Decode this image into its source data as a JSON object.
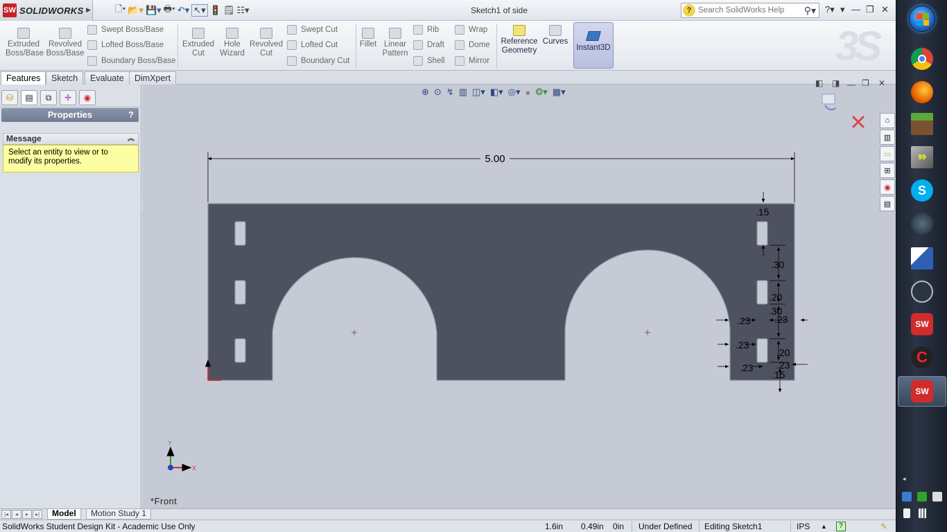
{
  "app": {
    "name": "SOLIDWORKS",
    "logo_text": "SW",
    "doc_title": "Sketch1 of side"
  },
  "search": {
    "placeholder": "Search SolidWorks Help"
  },
  "commands": {
    "extruded_boss": "Extruded Boss/Base",
    "revolved_boss": "Revolved Boss/Base",
    "swept_boss": "Swept Boss/Base",
    "lofted_boss": "Lofted Boss/Base",
    "boundary_boss": "Boundary Boss/Base",
    "extruded_cut": "Extruded Cut",
    "hole_wizard": "Hole Wizard",
    "revolved_cut": "Revolved Cut",
    "swept_cut": "Swept Cut",
    "lofted_cut": "Lofted Cut",
    "boundary_cut": "Boundary Cut",
    "fillet": "Fillet",
    "linear_pattern": "Linear Pattern",
    "rib": "Rib",
    "draft": "Draft",
    "shell": "Shell",
    "wrap": "Wrap",
    "dome": "Dome",
    "mirror": "Mirror",
    "reference_geometry": "Reference Geometry",
    "curves": "Curves",
    "instant3d": "Instant3D"
  },
  "tabs": [
    "Features",
    "Sketch",
    "Evaluate",
    "DimXpert"
  ],
  "panel": {
    "title": "Properties",
    "help": "?",
    "message_header": "Message",
    "message_text": "Select an entity to view or to modify its properties."
  },
  "sketch": {
    "overall_width": "5.00",
    "dims": {
      "top_margin": ".15",
      "slot_spacing": ".30",
      "slot_height": ".20",
      "slot_spacing_2": ".30",
      "left_offset": ".23",
      "right_offset": ".23",
      "mid_offset": ".23",
      "slot_height_2": ".20",
      "bottom_offset": ".23",
      "lower_offset": ".23",
      "bottom_margin": ".15"
    },
    "colors": {
      "body": "#4e5260",
      "background": "#c6cad4",
      "dimension": "#000000"
    }
  },
  "triad": {
    "x_label": "X",
    "y_label": "Y"
  },
  "view_label": "*Front",
  "bottom_tabs": [
    "Model",
    "Motion Study 1"
  ],
  "status": {
    "kit": "SolidWorks Student Design Kit - Academic Use Only",
    "x": "1.6in",
    "y": "0.49in",
    "z": "0in",
    "state": "Under Defined",
    "editing": "Editing Sketch1",
    "units": "IPS"
  },
  "taskbar": {
    "apps": [
      "Chrome",
      "Firefox",
      "Minecraft",
      "Desktop",
      "Skype",
      "Steam",
      "Paint",
      "Inkscape",
      "SolidWorks",
      "CCleaner",
      "SolidWorks Active"
    ]
  }
}
